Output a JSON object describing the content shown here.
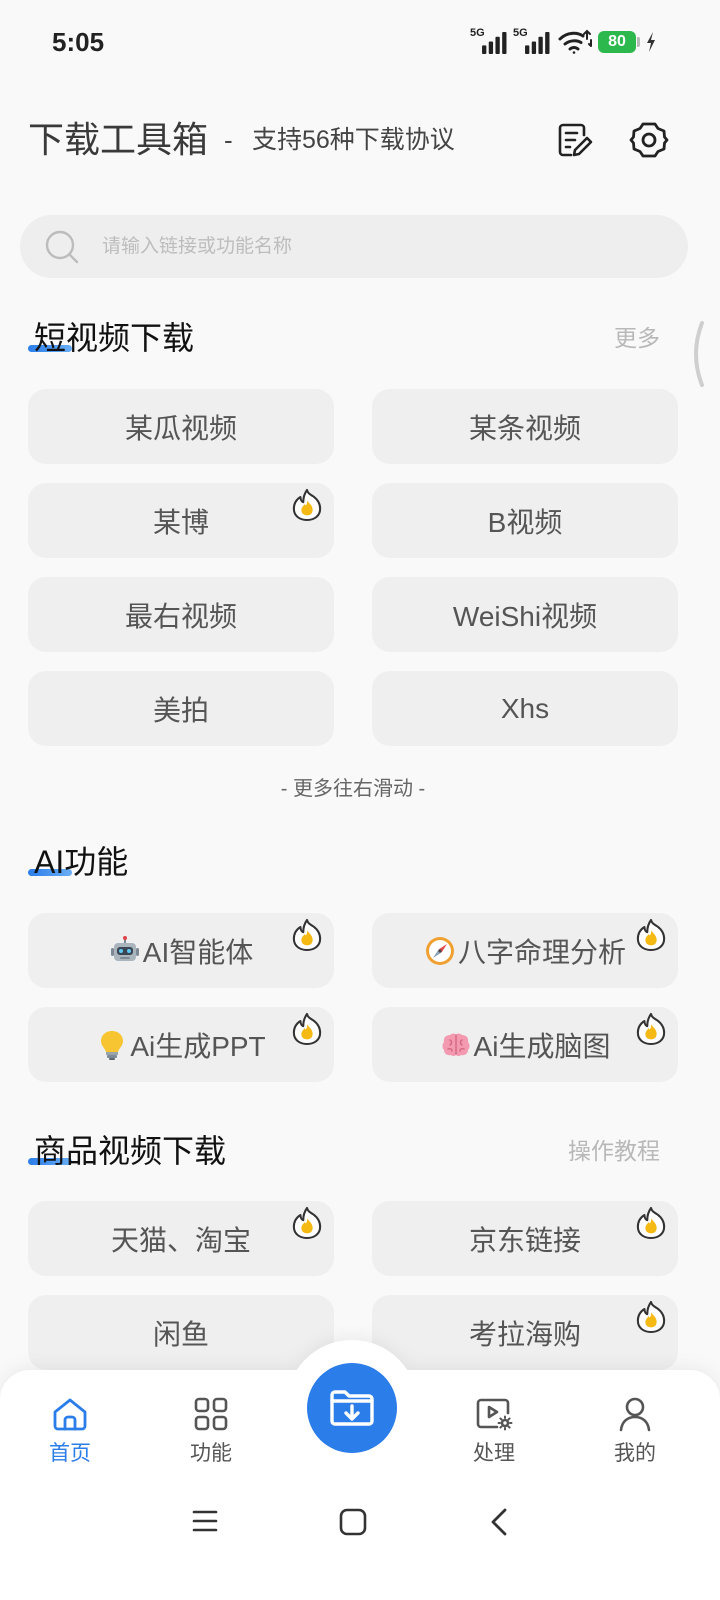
{
  "status_bar": {
    "time": "5:05",
    "network_1": "5G",
    "network_2": "5G",
    "battery_level": "80",
    "icons": [
      "cellular-signal-icon",
      "cellular-signal-icon",
      "wifi-icon",
      "battery-icon",
      "charging-bolt-icon"
    ]
  },
  "header": {
    "title": "下载工具箱",
    "separator": "-",
    "subtitle": "支持56种下载协议",
    "icons": {
      "notes": "notes-edit-icon",
      "settings": "settings-icon"
    }
  },
  "search": {
    "placeholder": "请输入链接或功能名称",
    "icon": "search-icon"
  },
  "sections": [
    {
      "title": "短视频下载",
      "action": "更多",
      "items": [
        {
          "label": "某瓜视频",
          "hot": false
        },
        {
          "label": "某条视频",
          "hot": false
        },
        {
          "label": "某博",
          "hot": true
        },
        {
          "label": "B视频",
          "hot": false
        },
        {
          "label": "最右视频",
          "hot": false
        },
        {
          "label": "WeiShi视频",
          "hot": false
        },
        {
          "label": "美拍",
          "hot": false
        },
        {
          "label": "Xhs",
          "hot": false
        }
      ],
      "footer": "- 更多往右滑动 -"
    },
    {
      "title": "AI功能",
      "items": [
        {
          "icon": "robot-icon",
          "label": "AI智能体",
          "hot": true
        },
        {
          "icon": "compass-icon",
          "label": "八字命理分析",
          "hot": true
        },
        {
          "icon": "lightbulb-icon",
          "label": "Ai生成PPT",
          "hot": true
        },
        {
          "icon": "brain-icon",
          "label": "Ai生成脑图",
          "hot": true
        }
      ]
    },
    {
      "title": "商品视频下载",
      "action": "操作教程",
      "items": [
        {
          "label": "天猫、淘宝",
          "hot": true
        },
        {
          "label": "京东链接",
          "hot": true
        },
        {
          "label": "闲鱼",
          "hot": false
        },
        {
          "label": "考拉海购",
          "hot": true
        }
      ]
    }
  ],
  "hot_badge_icon": "hot-fire-icon",
  "bottom_nav": {
    "items": [
      {
        "label": "首页",
        "icon": "home-icon",
        "active": true
      },
      {
        "label": "功能",
        "icon": "grid-icon",
        "active": false
      },
      {
        "label": "处理",
        "icon": "video-process-icon",
        "active": false
      },
      {
        "label": "我的",
        "icon": "profile-icon",
        "active": false
      }
    ],
    "center_button_icon": "folder-download-icon"
  },
  "system_nav": {
    "icons": [
      "menu-icon",
      "home-button-icon",
      "back-icon"
    ]
  },
  "theme": {
    "accent": "#2b7de9",
    "battery": "#2db84d",
    "hot_badge": "#f5b914",
    "button_bg": "#efefef",
    "page_bg": "#f9f9f9"
  }
}
